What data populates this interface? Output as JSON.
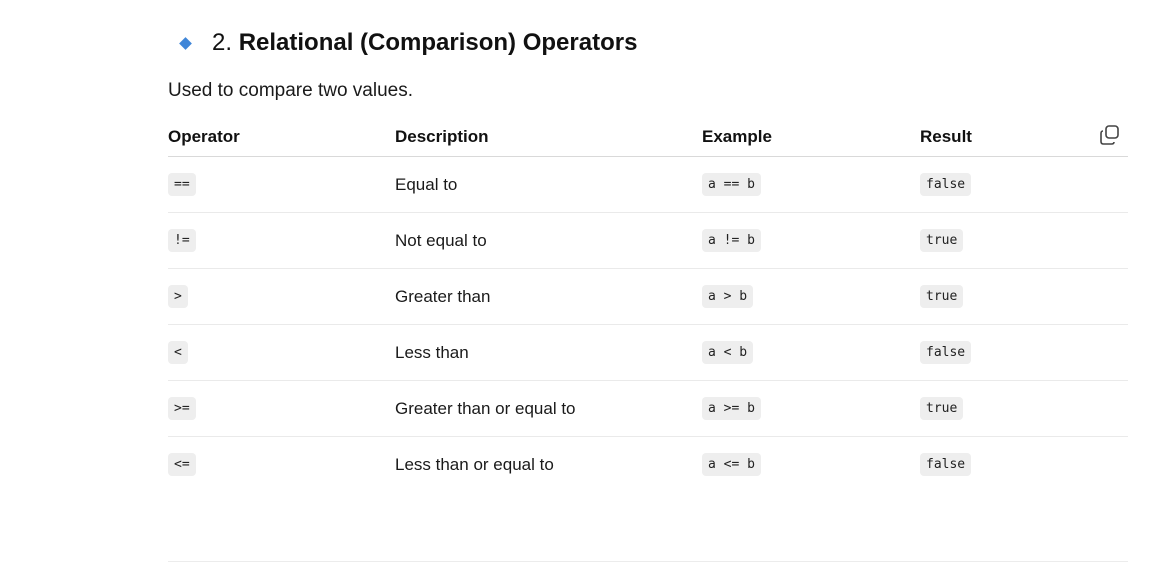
{
  "section": {
    "number": "2.",
    "title": "Relational (Comparison) Operators",
    "intro": "Used to compare two values.",
    "bullet_color": "#3f86d8"
  },
  "table": {
    "headers": [
      "Operator",
      "Description",
      "Example",
      "Result"
    ],
    "rows": [
      {
        "operator": "==",
        "description": "Equal to",
        "example": "a == b",
        "result": "false"
      },
      {
        "operator": "!=",
        "description": "Not equal to",
        "example": "a != b",
        "result": "true"
      },
      {
        "operator": ">",
        "description": "Greater than",
        "example": "a > b",
        "result": "true"
      },
      {
        "operator": "<",
        "description": "Less than",
        "example": "a < b",
        "result": "false"
      },
      {
        "operator": ">=",
        "description": "Greater than or equal to",
        "example": "a >= b",
        "result": "true"
      },
      {
        "operator": "<=",
        "description": "Less than or equal to",
        "example": "a <= b",
        "result": "false"
      }
    ]
  },
  "toolbar": {
    "copy_icon": "copy-icon"
  }
}
